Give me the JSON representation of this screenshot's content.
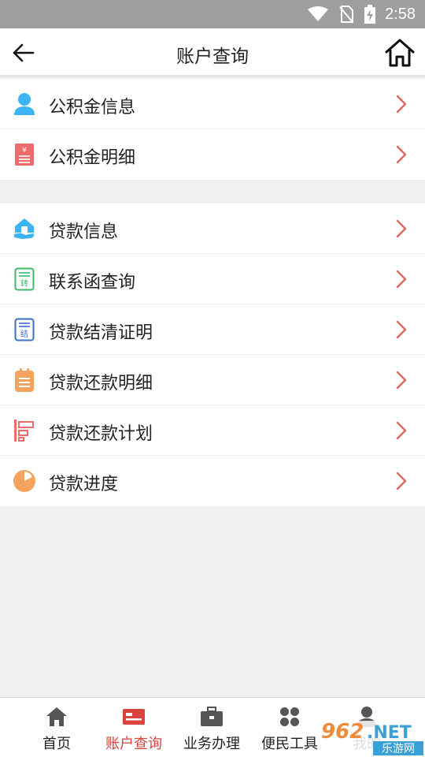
{
  "status_bar": {
    "time": "2:58",
    "icons": [
      "wifi-icon",
      "no-sim-icon",
      "battery-charging-icon"
    ]
  },
  "header": {
    "title": "账户查询",
    "back_icon": "back-arrow-icon",
    "home_icon": "home-icon"
  },
  "groups": [
    {
      "items": [
        {
          "label": "公积金信息",
          "icon": "person-icon",
          "color": "#3ab4f2"
        },
        {
          "label": "公积金明细",
          "icon": "receipt-yen-icon",
          "color": "#ee6b6b"
        }
      ]
    },
    {
      "items": [
        {
          "label": "贷款信息",
          "icon": "house-hand-icon",
          "color": "#3ab4f2"
        },
        {
          "label": "联系函查询",
          "icon": "transfer-doc-icon",
          "color": "#3fb86a"
        },
        {
          "label": "贷款结清证明",
          "icon": "settled-doc-icon",
          "color": "#3d6fc4"
        },
        {
          "label": "贷款还款明细",
          "icon": "clipboard-icon",
          "color": "#f5a25d"
        },
        {
          "label": "贷款还款计划",
          "icon": "plan-bars-icon",
          "color": "#ee6b6b"
        },
        {
          "label": "贷款进度",
          "icon": "progress-pie-icon",
          "color": "#f5a25d"
        }
      ]
    }
  ],
  "chevron_color": "#e0675f",
  "tab_bar": {
    "tabs": [
      {
        "label": "首页",
        "icon": "home-tab-icon",
        "active": false
      },
      {
        "label": "账户查询",
        "icon": "account-card-icon",
        "active": true
      },
      {
        "label": "业务办理",
        "icon": "briefcase-icon",
        "active": false
      },
      {
        "label": "便民工具",
        "icon": "four-dots-icon",
        "active": false
      },
      {
        "label": "我的",
        "icon": "user-tab-icon",
        "active": false
      }
    ],
    "active_color": "#d9443d"
  },
  "watermark": {
    "text": "962.NET",
    "subtext": "乐游网"
  }
}
